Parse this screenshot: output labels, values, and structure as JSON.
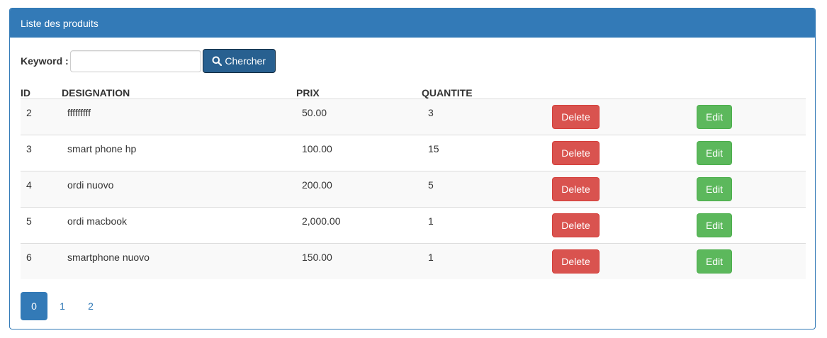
{
  "panel": {
    "title": "Liste des produits"
  },
  "search": {
    "label": "Keyword :",
    "value": "",
    "placeholder": "",
    "button_label": "Chercher",
    "button_icon": "search-icon"
  },
  "table": {
    "headers": {
      "id": "ID",
      "designation": "DESIGNATION",
      "prix": "PRIX",
      "quantite": "QUANTITE"
    },
    "rows": [
      {
        "id": "2",
        "designation": "fffffffff",
        "prix": "50.00",
        "quantite": "3",
        "delete_label": "Delete",
        "edit_label": "Edit"
      },
      {
        "id": "3",
        "designation": "smart phone hp",
        "prix": "100.00",
        "quantite": "15",
        "delete_label": "Delete",
        "edit_label": "Edit"
      },
      {
        "id": "4",
        "designation": "ordi nuovo",
        "prix": "200.00",
        "quantite": "5",
        "delete_label": "Delete",
        "edit_label": "Edit"
      },
      {
        "id": "5",
        "designation": "ordi macbook",
        "prix": "2,000.00",
        "quantite": "1",
        "delete_label": "Delete",
        "edit_label": "Edit"
      },
      {
        "id": "6",
        "designation": "smartphone nuovo",
        "prix": "150.00",
        "quantite": "1",
        "delete_label": "Delete",
        "edit_label": "Edit"
      }
    ]
  },
  "pagination": {
    "pages": [
      "0",
      "1",
      "2"
    ],
    "active": "0"
  },
  "colors": {
    "primary": "#337ab7",
    "danger": "#d9534f",
    "success": "#5cb85c",
    "search_button": "#286090"
  }
}
